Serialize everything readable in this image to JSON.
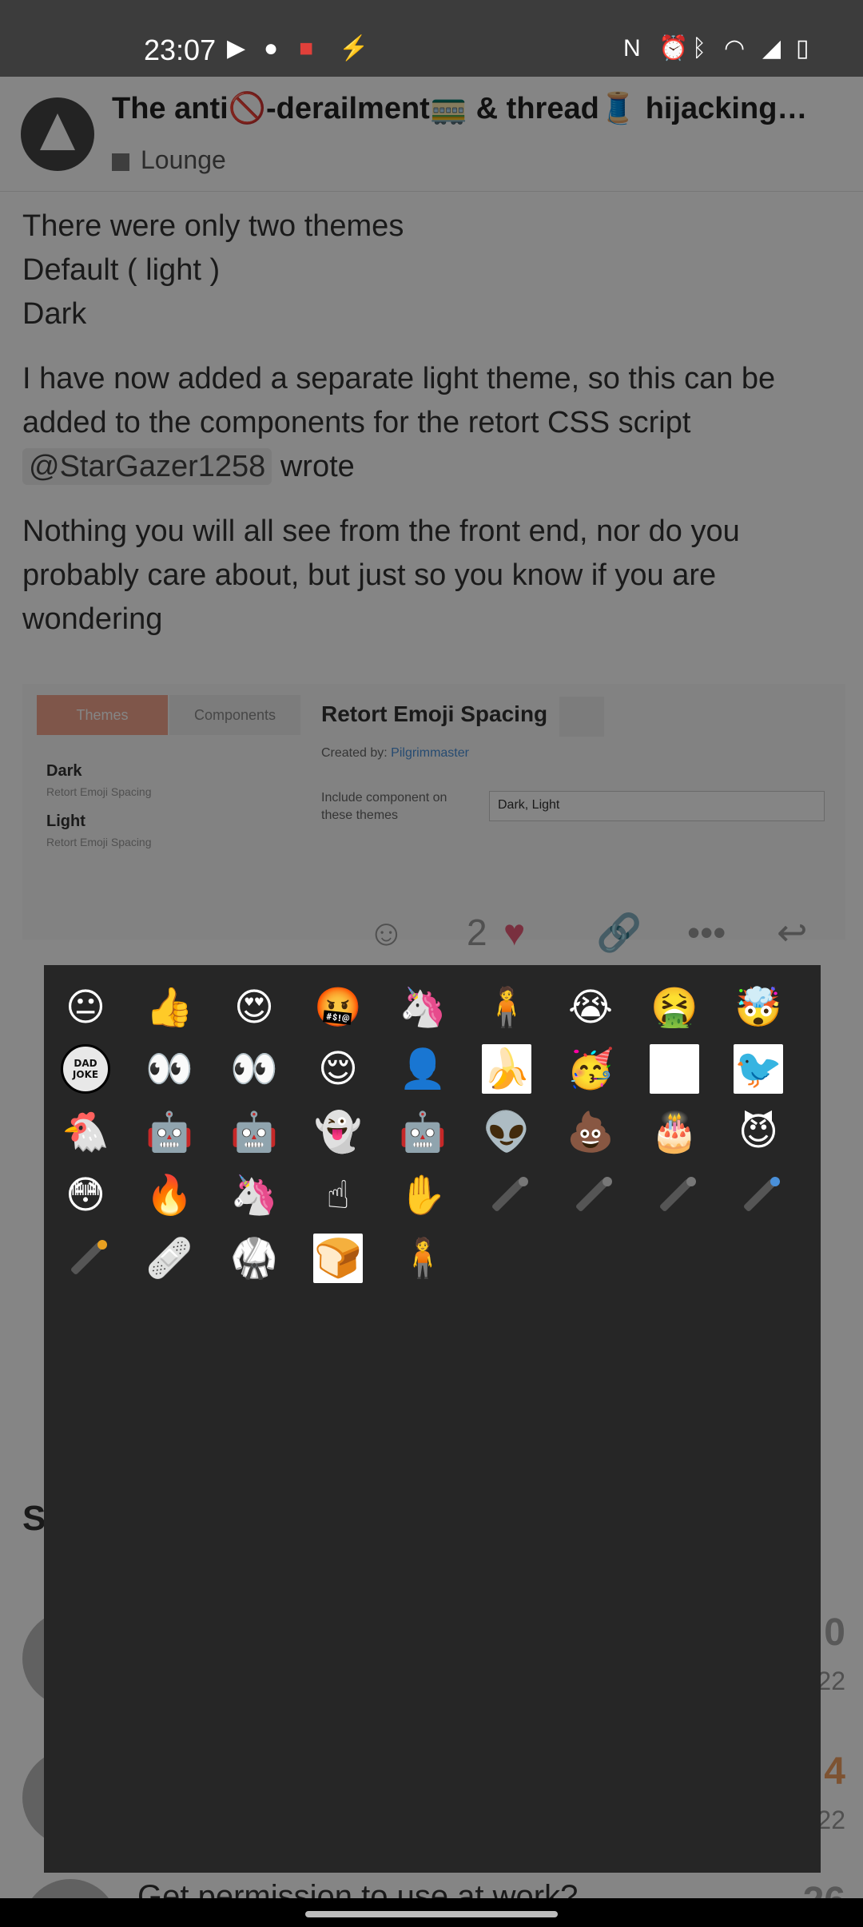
{
  "status_bar": {
    "time": "23:07",
    "left_icons": [
      "youtube-icon",
      "reddit-icon",
      "app-icon",
      "bolt-icon"
    ],
    "right_icons": [
      "nfc-icon",
      "alarm-icon",
      "bluetooth-icon",
      "wifi-icon",
      "signal-icon",
      "battery-icon"
    ]
  },
  "topic": {
    "title": "The anti🚫-derailment🚃 & thread🧵 hijacking…",
    "category": "Lounge"
  },
  "post": {
    "p1_lines": [
      "There were only two themes",
      "Default ( light )",
      "Dark"
    ],
    "p2_text": "I have now added a separate light theme, so this can be added to the components for the retort CSS script",
    "p2_mention": "@StarGazer1258",
    "p2_tail": "wrote",
    "p3_text": "Nothing you will all see from the front end, nor do you probably care about, but just so you know if you are wondering"
  },
  "embed": {
    "tab_themes": "Themes",
    "tab_components": "Components",
    "theme1_name": "Dark",
    "theme1_sub": "Retort Emoji Spacing",
    "theme2_name": "Light",
    "theme2_sub": "Retort Emoji Spacing",
    "component_title": "Retort Emoji Spacing",
    "created_by_label": "Created by:",
    "created_by_user": "Pilgrimmaster",
    "include_label": "Include component on these themes",
    "include_value": "Dark, Light"
  },
  "actions": {
    "like_count": "2"
  },
  "suggested": {
    "heading": "S",
    "rows": [
      {
        "count": "0",
        "date": "22"
      },
      {
        "count": "4",
        "date": "22"
      },
      {
        "title": "Get permission to use at work?",
        "count": "26"
      }
    ]
  },
  "picker": {
    "emojis": [
      {
        "name": "neutral-face-icon",
        "glyph": "😐"
      },
      {
        "name": "thumbs-up-icon",
        "glyph": "👍"
      },
      {
        "name": "heart-eyes-icon",
        "glyph": "😍"
      },
      {
        "name": "cursing-face-icon",
        "glyph": "🤬"
      },
      {
        "name": "flaming-unicorn-icon",
        "glyph": "🦄"
      },
      {
        "name": "vault-boy-icon",
        "glyph": "🧍"
      },
      {
        "name": "loudly-crying-icon",
        "glyph": "😭"
      },
      {
        "name": "vomiting-face-icon",
        "glyph": "🤮"
      },
      {
        "name": "exploding-head-icon",
        "glyph": "🤯"
      },
      {
        "name": "dad-joke-icon",
        "glyph": "DAD JOKE"
      },
      {
        "name": "shifty-eyes-icon",
        "glyph": "👀"
      },
      {
        "name": "wide-eyes-icon",
        "glyph": "👀"
      },
      {
        "name": "relieved-face-icon",
        "glyph": "😌"
      },
      {
        "name": "face-photo-icon",
        "glyph": "👤"
      },
      {
        "name": "dancing-banana-icon",
        "glyph": "🍌"
      },
      {
        "name": "party-face-icon",
        "glyph": "🥳"
      },
      {
        "name": "sketch-cat-icon",
        "glyph": "🐱"
      },
      {
        "name": "angry-bird-sketch-icon",
        "glyph": "🐦"
      },
      {
        "name": "chicken-icon",
        "glyph": "🐔"
      },
      {
        "name": "bender-robot-icon",
        "glyph": "🤖"
      },
      {
        "name": "cyborg-face-icon",
        "glyph": "🤖"
      },
      {
        "name": "ghost-face-icon",
        "glyph": "👻"
      },
      {
        "name": "robot-mask-icon",
        "glyph": "🤖"
      },
      {
        "name": "alien-icon",
        "glyph": "👽"
      },
      {
        "name": "poop-icon",
        "glyph": "💩"
      },
      {
        "name": "cake-icon",
        "glyph": "🎂"
      },
      {
        "name": "smiling-devil-icon",
        "glyph": "😈"
      },
      {
        "name": "flushed-face-icon",
        "glyph": "😳"
      },
      {
        "name": "fire-icon",
        "glyph": "🔥"
      },
      {
        "name": "unicorn-icon",
        "glyph": "🦄"
      },
      {
        "name": "pointing-hand-icon",
        "glyph": "☝"
      },
      {
        "name": "xray-hand-icon",
        "glyph": "✋"
      },
      {
        "name": "pen-gray-1-icon",
        "glyph": ""
      },
      {
        "name": "pen-gray-2-icon",
        "glyph": ""
      },
      {
        "name": "pen-gray-3-icon",
        "glyph": ""
      },
      {
        "name": "pen-blue-icon",
        "glyph": ""
      },
      {
        "name": "pen-orange-icon",
        "glyph": ""
      },
      {
        "name": "eraser-icon",
        "glyph": "🩹"
      },
      {
        "name": "hadouken-icon",
        "glyph": "🥋"
      },
      {
        "name": "toaster-icon",
        "glyph": "🍞"
      },
      {
        "name": "vault-boy-thumbs-icon",
        "glyph": "🧍"
      }
    ]
  },
  "colors": {
    "status_bar": "#3c3c3c",
    "picker_bg": "#262626",
    "heart": "#e85c7a"
  }
}
